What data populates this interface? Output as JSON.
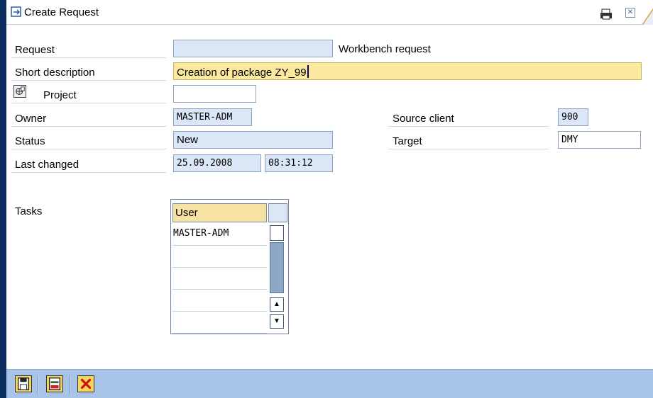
{
  "window": {
    "title": "Create Request",
    "print_icon": "print-icon",
    "close_icon": "close-icon"
  },
  "form": {
    "request": {
      "label": "Request",
      "value": "",
      "type_text": "Workbench request"
    },
    "short_description": {
      "label": "Short description",
      "value": "Creation of package ZY_99"
    },
    "project": {
      "label": "Project",
      "icon": "project-icon",
      "value": ""
    },
    "owner": {
      "label": "Owner",
      "value": "MASTER-ADM"
    },
    "status": {
      "label": "Status",
      "value": "New"
    },
    "last_changed": {
      "label": "Last changed",
      "date": "25.09.2008",
      "time": "08:31:12"
    },
    "source_client": {
      "label": "Source client",
      "value": "900"
    },
    "target": {
      "label": "Target",
      "value": "DMY"
    }
  },
  "tasks": {
    "label": "Tasks",
    "column_header": "User",
    "rows": [
      "MASTER-ADM",
      "",
      "",
      "",
      ""
    ]
  },
  "toolbar": {
    "buttons": [
      "save-icon",
      "local-request-icon",
      "cancel-icon"
    ]
  }
}
